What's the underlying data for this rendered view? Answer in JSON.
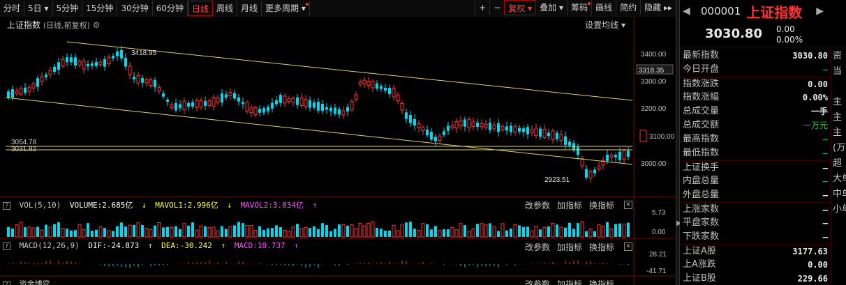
{
  "toolbar": {
    "periods": [
      "分时",
      "5日",
      "5分钟",
      "15分钟",
      "30分钟",
      "60分钟",
      "日线",
      "周线",
      "月线",
      "更多周期"
    ],
    "active_period": "日线",
    "zoom_in": "+",
    "zoom_out": "−",
    "tools": [
      "复权",
      "叠加",
      "筹码",
      "画线",
      "简约",
      "隐藏"
    ]
  },
  "main": {
    "title": "上证指数",
    "subtitle": "(日线,前复权)",
    "settings_label": "设置均线",
    "price_ticks": [
      "3400.00",
      "3300.00",
      "3200.00",
      "3100.00",
      "3000.00"
    ],
    "current_price_tag": "3318.35",
    "high_label": "3418.95",
    "low_label": "2923.51",
    "line1_label": "3054.78",
    "line2_label": "3031.82"
  },
  "volume": {
    "name": "VOL(5,10)",
    "volume": "VOLUME:2.685亿",
    "mavol1": "MAVOL1:2.996亿",
    "mavol2": "MAVOL2:3.034亿",
    "axis_top": "5.73",
    "axis_bottom": "0.00",
    "controls": [
      "改参数",
      "加指标",
      "换指标"
    ]
  },
  "macd": {
    "name": "MACD(12,26,9)",
    "dif": "DIF:-24.873",
    "dea": "DEA:-30.242",
    "macd": "MACD:10.737",
    "axis_top": "28.21",
    "axis_bottom": "-41.71",
    "controls": [
      "改参数",
      "加指标",
      "换指标"
    ]
  },
  "bottom_strip": {
    "name": "资金博弈",
    "controls": [
      "改参数",
      "加指标",
      "换指标"
    ]
  },
  "panel": {
    "code": "000001",
    "name": "上证指数",
    "price": "3030.80",
    "change": "0.00",
    "change_pct": "0.00%",
    "rows": [
      {
        "label": "最新指数",
        "value": "3030.80",
        "green": false
      },
      {
        "label": "今日开盘",
        "value": "—",
        "green": true
      },
      {
        "label": "指数涨跌",
        "value": "0.00",
        "green": false
      },
      {
        "label": "指数涨幅",
        "value": "0.00%",
        "green": false
      },
      {
        "label": "总成交量",
        "value": "一手",
        "green": false
      },
      {
        "label": "总成交额",
        "value": "一万元",
        "green": true
      },
      {
        "label": "最高指数",
        "value": "—",
        "green": true
      },
      {
        "label": "最低指数",
        "value": "—",
        "green": true
      },
      {
        "label": "上证换手",
        "value": "—",
        "green": false
      },
      {
        "label": "内盘总量",
        "value": "—",
        "green": true
      },
      {
        "label": "外盘总量",
        "value": "—",
        "green": false
      },
      {
        "label": "上涨家数",
        "value": "—",
        "green": false
      },
      {
        "label": "平盘家数",
        "value": "—",
        "green": false
      },
      {
        "label": "下跌家数",
        "value": "—",
        "green": false
      },
      {
        "label": "上证A股",
        "value": "3177.63",
        "green": false
      },
      {
        "label": "上A涨跌",
        "value": "0.00",
        "green": false
      },
      {
        "label": "上证B股",
        "value": "229.66",
        "green": false
      }
    ],
    "side_labels": [
      "资",
      "当",
      "",
      "主",
      "主",
      "主",
      "(万元",
      "超",
      "大单",
      "中单",
      "小单"
    ]
  },
  "colors": {
    "up": "#ff3333",
    "down": "#00d8f0",
    "trend": "#e0d060",
    "accent": "#ff3333"
  }
}
